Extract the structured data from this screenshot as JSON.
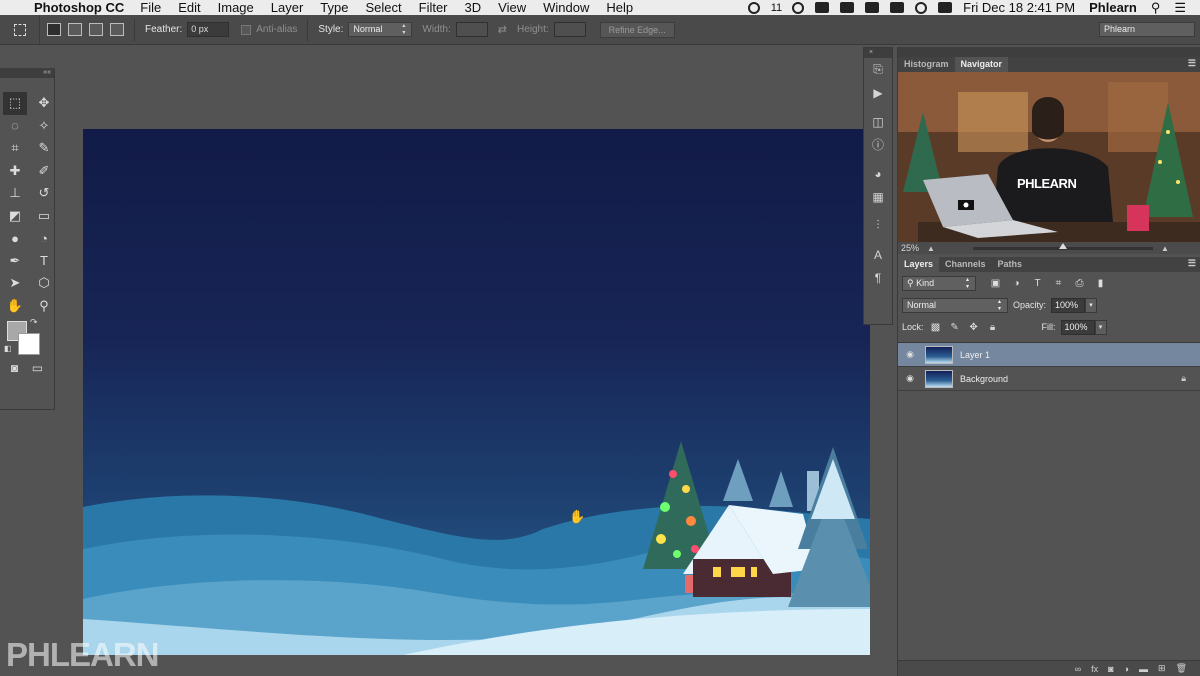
{
  "menubar": {
    "apple_icon": "apple-logo",
    "app_name": "Photoshop CC",
    "menus": [
      "File",
      "Edit",
      "Image",
      "Layer",
      "Type",
      "Select",
      "Filter",
      "3D",
      "View",
      "Window",
      "Help"
    ],
    "cc_badge": "11",
    "datetime": "Fri Dec 18  2:41 PM",
    "user": "Phlearn"
  },
  "options_bar": {
    "feather_label": "Feather:",
    "feather_value": "0 px",
    "antialias_label": "Anti-alias",
    "style_label": "Style:",
    "style_value": "Normal",
    "width_label": "Width:",
    "height_label": "Height:",
    "refine_edge_label": "Refine Edge...",
    "workspace_value": "Phlearn"
  },
  "tools_panel": {
    "tools": [
      {
        "name": "rectangular-marquee",
        "glyph": "⬚"
      },
      {
        "name": "move",
        "glyph": "✥"
      },
      {
        "name": "lasso",
        "glyph": "◌"
      },
      {
        "name": "magic-wand",
        "glyph": "✧"
      },
      {
        "name": "crop",
        "glyph": "⌗"
      },
      {
        "name": "eyedropper",
        "glyph": "✎"
      },
      {
        "name": "healing-brush",
        "glyph": "✚"
      },
      {
        "name": "brush",
        "glyph": "✐"
      },
      {
        "name": "clone-stamp",
        "glyph": "⊥"
      },
      {
        "name": "history-brush",
        "glyph": "↺"
      },
      {
        "name": "eraser",
        "glyph": "◩"
      },
      {
        "name": "gradient",
        "glyph": "▭"
      },
      {
        "name": "blur",
        "glyph": "●"
      },
      {
        "name": "dodge",
        "glyph": "◔"
      },
      {
        "name": "pen",
        "glyph": "✒"
      },
      {
        "name": "type",
        "glyph": "T"
      },
      {
        "name": "path-selection",
        "glyph": "➤"
      },
      {
        "name": "shape",
        "glyph": "⬡"
      },
      {
        "name": "hand",
        "glyph": "✋"
      },
      {
        "name": "zoom",
        "glyph": "⚲"
      }
    ]
  },
  "canvas": {
    "watermark": "PHLEARN"
  },
  "navigator_panel": {
    "tabs": [
      "Histogram",
      "Navigator"
    ],
    "active_tab": "Navigator",
    "shirt_text": "PHLEARN",
    "zoom_level": "25%",
    "zoom_slider_position": 0.5
  },
  "layers_panel": {
    "tabs": [
      "Layers",
      "Channels",
      "Paths"
    ],
    "active_tab": "Layers",
    "filter_kind": "Kind",
    "blend_mode": "Normal",
    "opacity_label": "Opacity:",
    "opacity_value": "100%",
    "lock_label": "Lock:",
    "fill_label": "Fill:",
    "fill_value": "100%",
    "layers": [
      {
        "name": "Layer 1",
        "selected": true,
        "visible": true,
        "locked": false
      },
      {
        "name": "Background",
        "selected": false,
        "visible": true,
        "locked": true
      }
    ]
  },
  "colors": {
    "ui_bg": "#535353",
    "selected_layer": "#74879e",
    "menubar_bg": "#ececec"
  }
}
